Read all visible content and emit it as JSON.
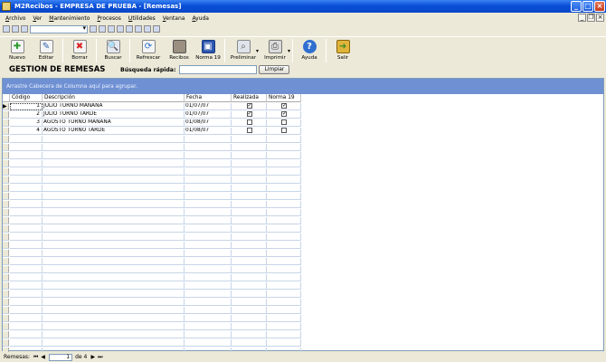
{
  "window": {
    "title": "M2Recibos - EMPRESA DE PRUEBA - [Remesas]",
    "buttons": [
      "minimize",
      "maximize",
      "close"
    ]
  },
  "menu": [
    "Archivo",
    "Ver",
    "Mantenimiento",
    "Procesos",
    "Utilidades",
    "Ventana",
    "Ayuda"
  ],
  "toolbar": {
    "nuevo": "Nuevo",
    "editar": "Editar",
    "borrar": "Borrar",
    "buscar": "Buscar",
    "refrescar": "Refrescar",
    "recibos": "Recibos",
    "norma19": "Norma 19",
    "preliminar": "Preliminar",
    "imprimir": "Imprimir",
    "ayuda": "Ayuda",
    "salir": "Salir"
  },
  "header": {
    "title": "GESTION  DE REMESAS",
    "quick_search_label": "Búsqueda rápida:",
    "quick_search_value": "",
    "clear_label": "Limpiar"
  },
  "grid": {
    "group_hint": "Arrastre Cabecera de Columna aquí para agrupar.",
    "columns": [
      "Código",
      "Descripción",
      "Fecha",
      "Realizada",
      "Norma 19"
    ],
    "rows": [
      {
        "codigo": "1",
        "descripcion": "JULIO TURNO MAÑANA",
        "fecha": "01/07/07",
        "realizada": true,
        "norma19": true
      },
      {
        "codigo": "2",
        "descripcion": "JULIO TURNO TARDE",
        "fecha": "01/07/07",
        "realizada": true,
        "norma19": true
      },
      {
        "codigo": "3",
        "descripcion": "AGOSTO TURNO MAÑANA",
        "fecha": "01/08/07",
        "realizada": false,
        "norma19": false
      },
      {
        "codigo": "4",
        "descripcion": "AGOSTO TURNO TARDE",
        "fecha": "01/08/07",
        "realizada": false,
        "norma19": false
      }
    ]
  },
  "status": {
    "label": "Remesas:",
    "page": "1",
    "of": "de 4"
  },
  "colors": {
    "titlebar": "#0a4fd8",
    "groupbar": "#6f91d3",
    "face": "#ece9d8"
  }
}
